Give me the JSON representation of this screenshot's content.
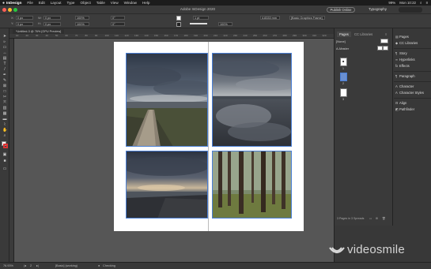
{
  "menubar": {
    "app": "InDesign",
    "items": [
      "File",
      "Edit",
      "Layout",
      "Type",
      "Object",
      "Table",
      "View",
      "Window",
      "Help"
    ],
    "status": {
      "battery": "99%",
      "clock": "Mon 10:22"
    }
  },
  "titlebar": {
    "title": "Adobe InDesign 2020",
    "publish_label": "Publish Online",
    "workspace": "Typography"
  },
  "control": {
    "x_value": "0 px",
    "y_value": "0 px",
    "w_value": "0 px",
    "h_value": "0 px",
    "stroke_value": "1 pt",
    "zoom_value": "100%",
    "angle_value": "0°",
    "fitting_value": "4.8333 mm",
    "object_style": "[Basic Graphics Frame]"
  },
  "document_tab": "*Untitled-3 @ 76% [GPU Preview]",
  "ruler_ticks": [
    "10",
    "20",
    "30",
    "40",
    "50",
    "60",
    "70",
    "80",
    "90",
    "100",
    "110",
    "120",
    "130",
    "140",
    "150",
    "160",
    "170",
    "180",
    "190",
    "200",
    "210",
    "220",
    "230",
    "240",
    "250",
    "260",
    "270",
    "280",
    "290",
    "300",
    "310",
    "320"
  ],
  "pages_panel": {
    "tabs": [
      "Pages",
      "CC Libraries"
    ],
    "masters": [
      "[None]",
      "A-Master"
    ],
    "page_numbers": [
      "1",
      "2",
      "3"
    ],
    "footer": "3 Pages in 3 Spreads"
  },
  "right_panel": {
    "items": [
      {
        "label": "Pages",
        "icon": "pages-icon"
      },
      {
        "label": "CC Libraries",
        "icon": "cc-libraries-icon"
      },
      {
        "label": "Story",
        "icon": "story-icon"
      },
      {
        "label": "Hyperlinks",
        "icon": "hyperlinks-icon"
      },
      {
        "label": "Effects",
        "icon": "effects-icon"
      },
      {
        "label": "Paragraph",
        "icon": "paragraph-icon"
      },
      {
        "label": "Character",
        "icon": "character-icon"
      },
      {
        "label": "Character Styles",
        "icon": "character-styles-icon"
      },
      {
        "label": "Align",
        "icon": "align-icon"
      },
      {
        "label": "Pathfinder",
        "icon": "pathfinder-icon"
      }
    ]
  },
  "statusbar": {
    "zoom": "76.93%",
    "page": "2",
    "style": "[Basic] (working)",
    "preflight": "Checking"
  },
  "watermark": "videosmile",
  "colors": {
    "accent": "#4a7fd6",
    "panel_bg": "#383838",
    "pasteboard": "#565656"
  }
}
